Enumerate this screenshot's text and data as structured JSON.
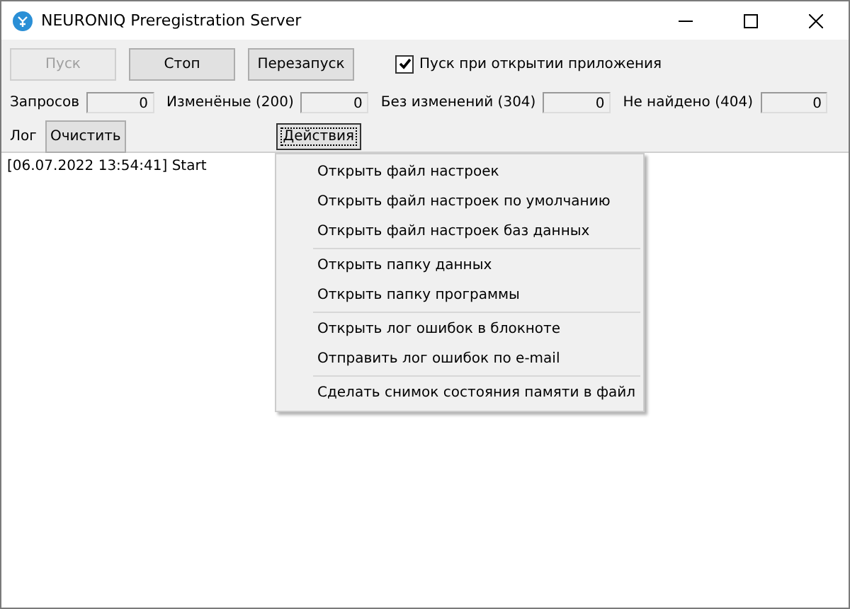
{
  "window": {
    "title": "NEURONIQ Preregistration Server"
  },
  "buttons": [
    {
      "label": "Пуск",
      "disabled": true
    },
    {
      "label": "Стоп",
      "disabled": false
    },
    {
      "label": "Перезапуск",
      "disabled": false
    }
  ],
  "autostart": {
    "label": "Пуск при открытии приложения",
    "checked": true
  },
  "counters": [
    {
      "label": "Запросов",
      "value": "0"
    },
    {
      "label": "Изменёные (200)",
      "value": "0"
    },
    {
      "label": "Без изменений (304)",
      "value": "0"
    },
    {
      "label": "Не найдено (404)",
      "value": "0"
    }
  ],
  "log_label": "Лог",
  "clear_button": "Очистить",
  "actions_button": {
    "label": "Действия",
    "focused": true
  },
  "log_lines": [
    "[06.07.2022 13:54:41] Start"
  ],
  "menu": [
    {
      "kind": "item",
      "label": "Открыть файл настроек"
    },
    {
      "kind": "item",
      "label": "Открыть файл настроек по умолчанию"
    },
    {
      "kind": "item",
      "label": "Открыть файл настроек баз данных"
    },
    {
      "kind": "separator"
    },
    {
      "kind": "item",
      "label": "Открыть папку данных"
    },
    {
      "kind": "item",
      "label": "Открыть папку программы"
    },
    {
      "kind": "separator"
    },
    {
      "kind": "item",
      "label": "Открыть лог ошибок в блокноте"
    },
    {
      "kind": "item",
      "label": "Отправить лог ошибок по e-mail"
    },
    {
      "kind": "separator"
    },
    {
      "kind": "item",
      "label": "Сделать снимок состояния памяти в файл"
    }
  ]
}
